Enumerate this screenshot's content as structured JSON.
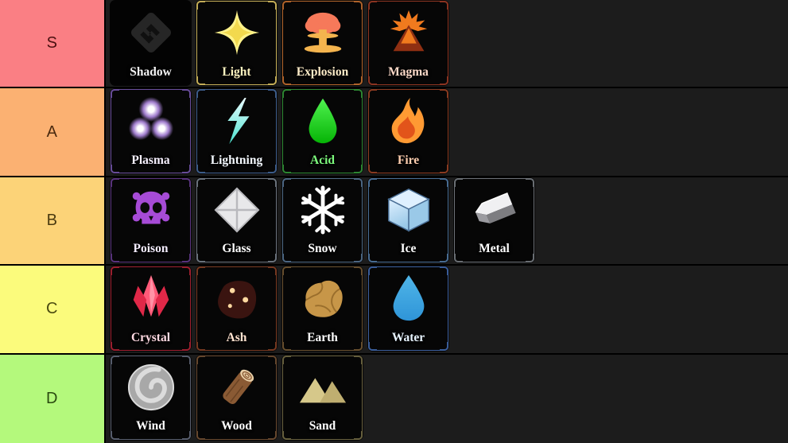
{
  "app": {
    "type": "tier-list",
    "background": "#1e1e1e"
  },
  "tiers": [
    {
      "label": "S",
      "color": "#fa7f84",
      "text_color": "#4a1010",
      "items": [
        {
          "name": "Shadow",
          "label_color": "#f2f2f2",
          "border_color": "none",
          "icon": "shadow-icon",
          "icon_color": "#262626",
          "icon_color2": "#101010"
        },
        {
          "name": "Light",
          "label_color": "#fdf3c0",
          "border_color": "#c9b25a",
          "icon": "light-sparkle-icon",
          "icon_color": "#fff38a",
          "icon_color2": "#f2d94e"
        },
        {
          "name": "Explosion",
          "label_color": "#fdecc8",
          "border_color": "#b4662c",
          "icon": "explosion-mushroom-icon",
          "icon_color": "#f6795a",
          "icon_color2": "#f4b44e"
        },
        {
          "name": "Magma",
          "label_color": "#fbd9c8",
          "border_color": "#8e3522",
          "icon": "magma-volcano-icon",
          "icon_color": "#f07a1e",
          "icon_color2": "#8f2f12"
        }
      ]
    },
    {
      "label": "A",
      "color": "#fbb островa",
      "color_hex": "#fbb172",
      "text_color": "#4a2a10",
      "items": [
        {
          "name": "Plasma",
          "label_color": "#f6f0ff",
          "border_color": "#6b4f9e",
          "icon": "plasma-orbs-icon",
          "icon_color": "#ffffff",
          "icon_color2": "#c79bff"
        },
        {
          "name": "Lightning",
          "label_color": "#f4f9ff",
          "border_color": "#3f5f8e",
          "icon": "lightning-bolt-icon",
          "icon_color": "#eafcff",
          "icon_color2": "#49e2d0"
        },
        {
          "name": "Acid",
          "label_color": "#7dfb7d",
          "border_color": "#2f8a34",
          "icon": "acid-drop-icon",
          "icon_color": "#4ff24f",
          "icon_color2": "#06b406"
        },
        {
          "name": "Fire",
          "label_color": "#ffcfb0",
          "border_color": "#8e3d22",
          "icon": "fire-flame-icon",
          "icon_color": "#ff9a33",
          "icon_color2": "#e2541a"
        }
      ]
    },
    {
      "label": "B",
      "color": "#fcd378",
      "text_color": "#4a3a10",
      "items": [
        {
          "name": "Poison",
          "label_color": "#f4edff",
          "border_color": "#5b3580",
          "icon": "poison-skull-icon",
          "icon_color": "#a64bd6",
          "icon_color2": "#7b2ea8"
        },
        {
          "name": "Glass",
          "label_color": "#ffffff",
          "border_color": "#6e7680",
          "icon": "glass-diamond-icon",
          "icon_color": "#e8e8ea",
          "icon_color2": "#b9b9bd"
        },
        {
          "name": "Snow",
          "label_color": "#ffffff",
          "border_color": "#4f6a86",
          "icon": "snowflake-icon",
          "icon_color": "#ffffff",
          "icon_color2": "#e6f4ff"
        },
        {
          "name": "Ice",
          "label_color": "#ffffff",
          "border_color": "#4a6f96",
          "icon": "ice-cube-icon",
          "icon_color": "#dff0ff",
          "icon_color2": "#9ac9e8"
        },
        {
          "name": "Metal",
          "label_color": "#ffffff",
          "border_color": "#6d7177",
          "icon": "metal-ingot-icon",
          "icon_color": "#f0f0f2",
          "icon_color2": "#9b9ba0"
        }
      ]
    },
    {
      "label": "C",
      "color": "#fbfb7c",
      "text_color": "#4a4a10",
      "items": [
        {
          "name": "Crystal",
          "label_color": "#ffd9e2",
          "border_color": "#a02030",
          "icon": "crystal-shards-icon",
          "icon_color": "#ff5a78",
          "icon_color2": "#e02848"
        },
        {
          "name": "Ash",
          "label_color": "#ffe2cf",
          "border_color": "#7a3a22",
          "icon": "ash-rock-icon",
          "icon_color": "#3a1410",
          "icon_color2": "#ffd9a0"
        },
        {
          "name": "Earth",
          "label_color": "#ffffff",
          "border_color": "#6b5230",
          "icon": "earth-boulder-icon",
          "icon_color": "#c79648",
          "icon_color2": "#9a6e2c"
        },
        {
          "name": "Water",
          "label_color": "#e8f4ff",
          "border_color": "#3c5f9e",
          "icon": "water-drop-icon",
          "icon_color": "#4fb5e8",
          "icon_color2": "#2f95d8"
        }
      ]
    },
    {
      "label": "D",
      "color": "#b4f97c",
      "text_color": "#2a4a10",
      "items": [
        {
          "name": "Wind",
          "label_color": "#ffffff",
          "border_color": "#5a6070",
          "icon": "wind-spiral-icon",
          "icon_color": "#dcdcdc",
          "icon_color2": "#a8a8a8"
        },
        {
          "name": "Wood",
          "label_color": "#ffffff",
          "border_color": "#6a4a30",
          "icon": "wood-log-icon",
          "icon_color": "#8a5a34",
          "icon_color2": "#e8cfa8"
        },
        {
          "name": "Sand",
          "label_color": "#ffffff",
          "border_color": "#6a6240",
          "icon": "sand-dunes-icon",
          "icon_color": "#d6c88a",
          "icon_color2": "#bfae70"
        }
      ]
    }
  ]
}
